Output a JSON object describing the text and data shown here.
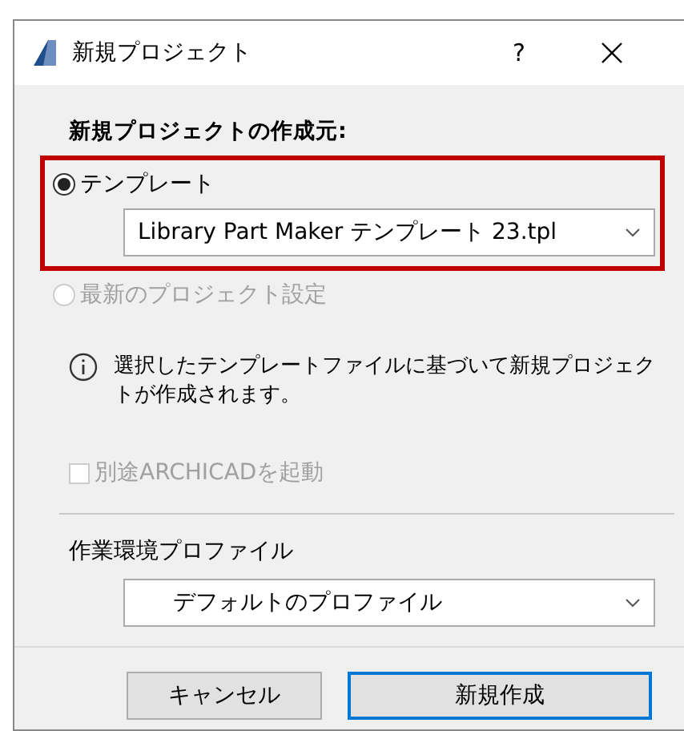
{
  "window": {
    "title": "新規プロジェクト",
    "help": "?"
  },
  "source": {
    "heading": "新規プロジェクトの作成元:",
    "options": [
      {
        "label": "テンプレート",
        "selected": true,
        "disabled": false,
        "highlighted": true,
        "dropdown": "Library Part Maker テンプレート 23.tpl"
      },
      {
        "label": "最新のプロジェクト設定",
        "selected": false,
        "disabled": true,
        "highlighted": false
      }
    ]
  },
  "info": "選択したテンプレートファイルに基づいて新規プロジェクトが作成されます。",
  "checkbox": {
    "label": "別途ARCHICADを起動",
    "checked": false,
    "disabled": true
  },
  "profile": {
    "label": "作業環境プロファイル",
    "value": "デフォルトのプロファイル"
  },
  "buttons": [
    {
      "label": "キャンセル",
      "default": false
    },
    {
      "label": "新規作成",
      "default": true
    }
  ]
}
